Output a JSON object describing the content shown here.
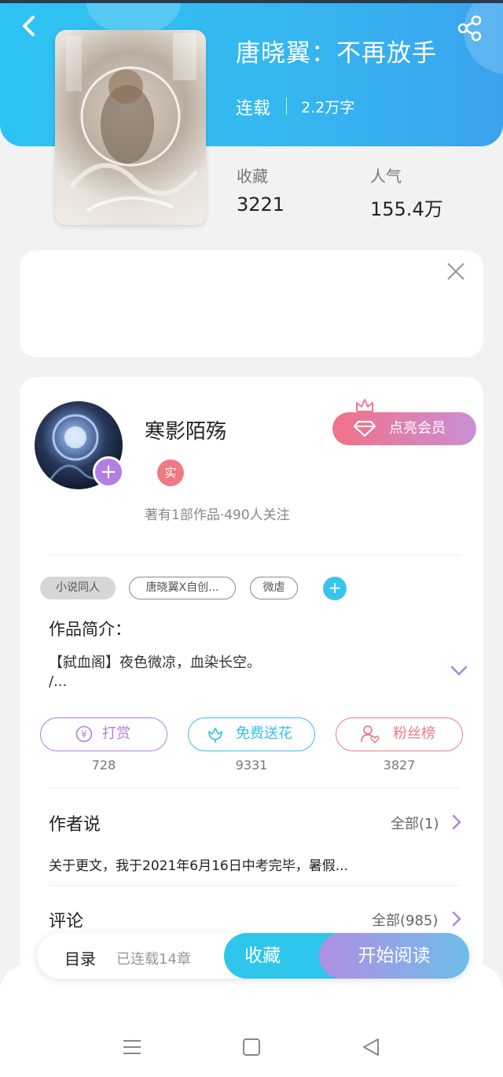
{
  "book": {
    "title": "唐晓翼：不再放手",
    "status": "连载",
    "word_count": "2.2万字",
    "favorites_label": "收藏",
    "favorites_value": "3221",
    "popularity_label": "人气",
    "popularity_value": "155.4万"
  },
  "author": {
    "name": "寒影陌殇",
    "real_badge": "实",
    "meta": "著有1部作品·490人关注",
    "vip_button": "点亮会员"
  },
  "tags": [
    "小说同人",
    "唐晓翼X自创...",
    "微虐"
  ],
  "intro": {
    "title": "作品简介：",
    "line1": "【弑血阁】夜色微凉，血染长空。",
    "line2": "/..."
  },
  "actions": [
    {
      "label": "打赏",
      "count": "728",
      "color": "#b07fd8"
    },
    {
      "label": "免费送花",
      "count": "9331",
      "color": "#35c2e8"
    },
    {
      "label": "粉丝榜",
      "count": "3827",
      "color": "#ec7a82"
    }
  ],
  "author_says": {
    "title": "作者说",
    "all": "全部(1)",
    "text": "关于更文，我于2021年6月16日中考完毕，暑假..."
  },
  "comments": {
    "title": "评论",
    "all": "全部(985)"
  },
  "bottom": {
    "toc": "目录",
    "toc_count": "已连载14章",
    "favorite": "收藏",
    "read": "开始阅读"
  },
  "colors": {
    "header": "#35b8f0",
    "accent_purple": "#b27ee3",
    "accent_cyan": "#2ec6ea",
    "vip_pink": "#f27187"
  }
}
